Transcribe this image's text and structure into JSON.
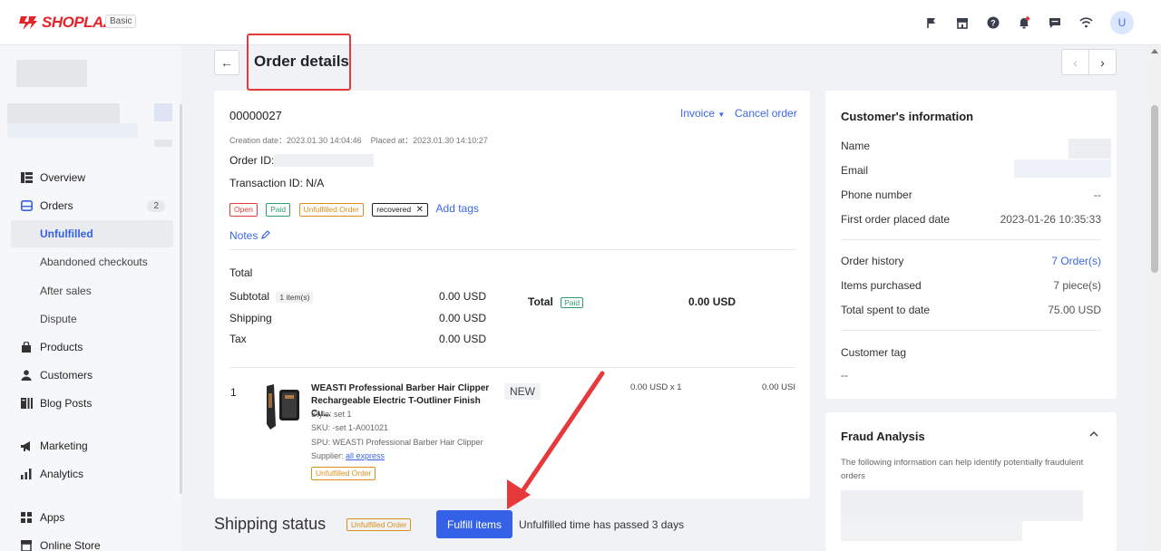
{
  "app": {
    "logo_text": "SHOPLAZZA",
    "plan": "Basic",
    "avatar_initial": "U",
    "accent_color": "#3560e8",
    "brand_color": "#e5242a"
  },
  "topbar": {
    "icons": [
      "flag-icon",
      "store-icon",
      "help-icon",
      "notification-icon",
      "message-icon",
      "wifi-icon"
    ]
  },
  "sidebar": {
    "items": [
      {
        "label": "Overview",
        "icon": "overview-icon"
      },
      {
        "label": "Orders",
        "icon": "orders-icon",
        "count": "2"
      },
      {
        "label": "Unfulfilled"
      },
      {
        "label": "Abandoned checkouts"
      },
      {
        "label": "After sales"
      },
      {
        "label": "Dispute"
      },
      {
        "label": "Products",
        "icon": "products-icon"
      },
      {
        "label": "Customers",
        "icon": "customers-icon"
      },
      {
        "label": "Blog Posts",
        "icon": "blog-icon"
      },
      {
        "label": "Marketing",
        "icon": "marketing-icon"
      },
      {
        "label": "Analytics",
        "icon": "analytics-icon"
      },
      {
        "label": "Apps",
        "icon": "apps-icon"
      },
      {
        "label": "Online Store",
        "icon": "online-store-icon"
      }
    ]
  },
  "page": {
    "title": "Order details"
  },
  "order": {
    "number": "00000027",
    "invoice_label": "Invoice",
    "cancel_label": "Cancel order",
    "creation_label": "Creation date：",
    "creation_date": "2023.01.30 14:04:46",
    "placed_label": "Placed at：",
    "placed_date": "2023.01.30 14:10:27",
    "order_id_label": "Order ID:",
    "transaction_label": "Transaction ID: N/A",
    "tags": {
      "open": "Open",
      "paid": "Paid",
      "unfulfilled": "Unfulfilled Order",
      "recovered": "recovered"
    },
    "add_tags": "Add tags",
    "notes": "Notes",
    "total_heading": "Total",
    "subtotal_label": "Subtotal",
    "items_count": "1 item(s)",
    "subtotal_value": "0.00 USD",
    "shipping_label": "Shipping",
    "shipping_value": "0.00 USD",
    "tax_label": "Tax",
    "tax_value": "0.00 USD",
    "total_label": "Total",
    "total_paid_badge": "Paid",
    "total_value": "0.00 USD"
  },
  "line_item": {
    "index": "1",
    "title": "WEASTI Professional Barber Hair Clipper Rechargeable Electric T-Outliner Finish Cu...",
    "badge": "NEW",
    "price_qty": "0.00 USD x 1",
    "line_total": "0.00 USI",
    "style": "Style: set 1",
    "sku": "SKU: -set 1-A001021",
    "spu": "SPU: WEASTI Professional Barber Hair Clipper",
    "supplier_label": "Supplier: ",
    "supplier_link": "all express",
    "status_badge": "Unfulfilled Order"
  },
  "shipping": {
    "title": "Shipping status",
    "badge": "Unfulfilled Order",
    "fulfill_button": "Fulfill items",
    "time_text": "Unfulfilled time has passed 3 days"
  },
  "customer": {
    "title": "Customer's information",
    "name_label": "Name",
    "email_label": "Email",
    "phone_label": "Phone number",
    "phone_value": "--",
    "first_order_label": "First order placed date",
    "first_order_value": "2023-01-26 10:35:33",
    "history_label": "Order history",
    "history_value": "7 Order(s)",
    "items_label": "Items purchased",
    "items_value": "7 piece(s)",
    "spent_label": "Total spent to date",
    "spent_value": "75.00 USD",
    "tag_label": "Customer tag",
    "tag_value": "--"
  },
  "fraud": {
    "title": "Fraud Analysis",
    "description": "The following information can help identify potentially fraudulent orders"
  }
}
